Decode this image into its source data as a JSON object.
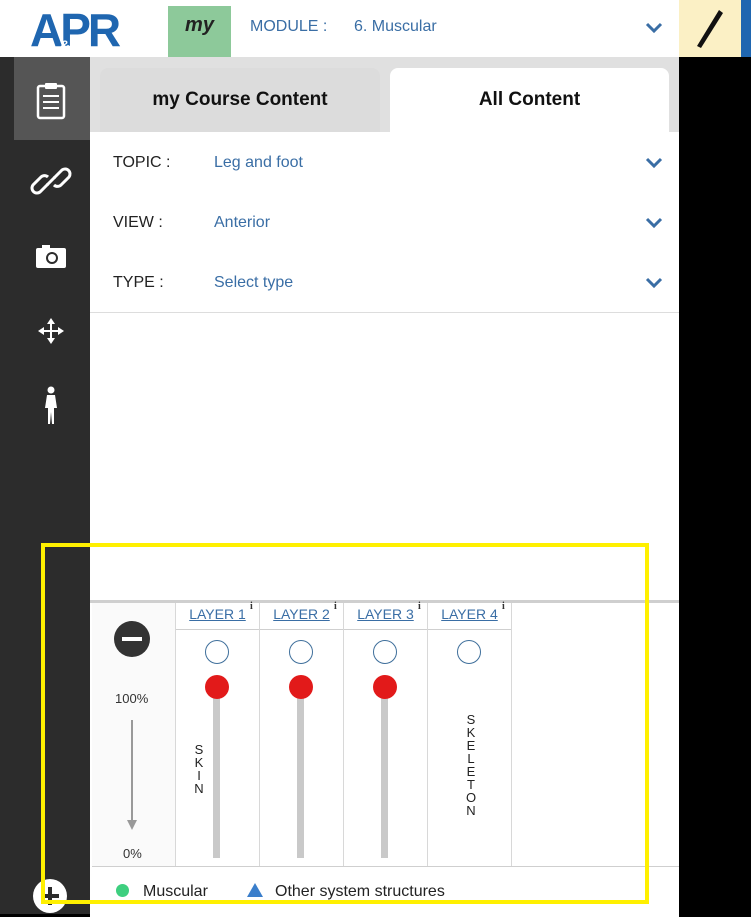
{
  "header": {
    "logo": "APR",
    "my_badge": "my",
    "module_label": "MODULE :",
    "module_value": "6. Muscular"
  },
  "tabs": [
    "my Course Content",
    "All Content"
  ],
  "filters": [
    {
      "label": "TOPIC :",
      "value": "Leg and foot"
    },
    {
      "label": "VIEW :",
      "value": "Anterior"
    },
    {
      "label": "TYPE :",
      "value": "Select type"
    }
  ],
  "layers": {
    "opacity_top": "100%",
    "opacity_bottom": "0%",
    "columns": [
      {
        "label": "LAYER 1",
        "name": "SKIN",
        "opacity": 100
      },
      {
        "label": "LAYER 2",
        "name": "",
        "opacity": 100
      },
      {
        "label": "LAYER 3",
        "name": "",
        "opacity": 100
      },
      {
        "label": "LAYER 4",
        "name": "SKELETON"
      }
    ]
  },
  "legend": {
    "item1": "Muscular",
    "item2": "Other system structures",
    "colors": {
      "muscular": "#3ecf7f",
      "other": "#3a7ecb"
    }
  },
  "colors": {
    "accent": "#3a6ea5",
    "highlight": "#fff000",
    "slider_knob": "#e21a1a"
  }
}
